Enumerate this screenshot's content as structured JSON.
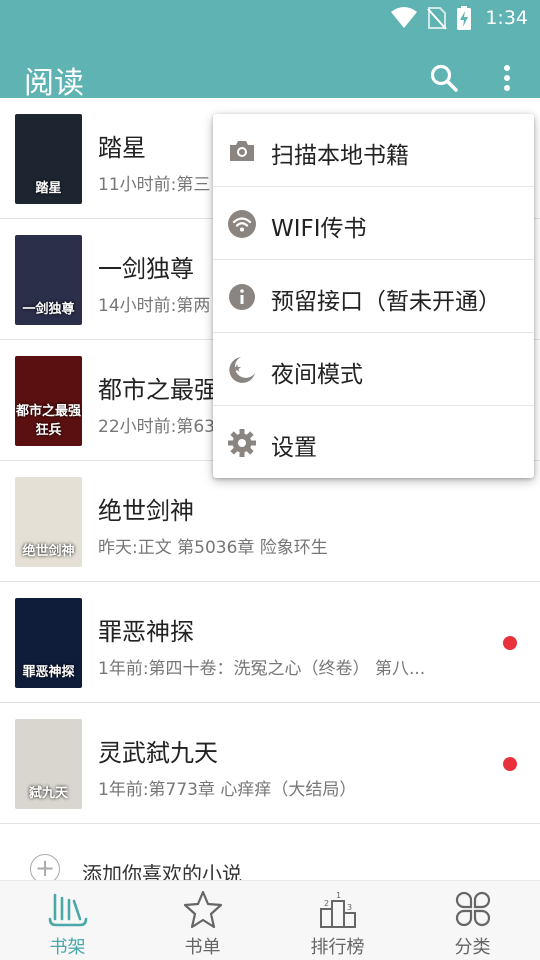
{
  "status_bar": {
    "time": "1:34"
  },
  "app_bar": {
    "title": "阅读"
  },
  "books": [
    {
      "title": "踏星",
      "subtitle": "11小时前:第三",
      "cover_text": "踏星",
      "cover_bg": "#1c2530",
      "has_update": false
    },
    {
      "title": "一剑独尊",
      "subtitle": "14小时前:第两",
      "cover_text": "一剑独尊",
      "cover_bg": "#2b2f4a",
      "has_update": false
    },
    {
      "title": "都市之最强",
      "subtitle": "22小时前:第63",
      "cover_text": "都市之最强狂兵",
      "cover_bg": "#5a1010",
      "has_update": false
    },
    {
      "title": "绝世剑神",
      "subtitle": "昨天:正文 第5036章 险象环生",
      "cover_text": "绝世剑神",
      "cover_bg": "#e4e0d6",
      "has_update": false
    },
    {
      "title": "罪恶神探",
      "subtitle": "1年前:第四十卷：洗冤之心（终卷） 第八...",
      "cover_text": "罪恶神探",
      "cover_bg": "#0f1d3a",
      "has_update": true
    },
    {
      "title": "灵武弑九天",
      "subtitle": "1年前:第773章 心痒痒（大结局）",
      "cover_text": "弑九天",
      "cover_bg": "#d9d6d0",
      "has_update": true
    }
  ],
  "add_book": {
    "label": "添加你喜欢的小说"
  },
  "bottom_nav": [
    {
      "label": "书架",
      "icon": "bookshelf-icon",
      "active": true
    },
    {
      "label": "书单",
      "icon": "star-icon",
      "active": false
    },
    {
      "label": "排行榜",
      "icon": "podium-icon",
      "active": false
    },
    {
      "label": "分类",
      "icon": "category-icon",
      "active": false
    }
  ],
  "menu": [
    {
      "label": "扫描本地书籍",
      "icon": "camera-icon"
    },
    {
      "label": "WIFI传书",
      "icon": "wifi-icon"
    },
    {
      "label": "预留接口（暂未开通）",
      "icon": "info-icon"
    },
    {
      "label": "夜间模式",
      "icon": "night-mode-icon"
    },
    {
      "label": "设置",
      "icon": "gear-icon"
    }
  ],
  "colors": {
    "accent": "#5fb3b3",
    "active_nav": "#4aa8a8",
    "badge": "#e8313b",
    "menu_icon": "#8a8580"
  }
}
